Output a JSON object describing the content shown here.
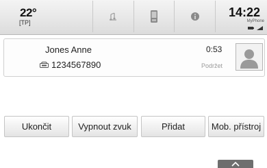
{
  "status": {
    "temperature": "22°",
    "temp_mode": "[TP]",
    "time": "14:22",
    "operator": "MyPhone"
  },
  "tabs": [
    {
      "icon": "music-note-icon"
    },
    {
      "icon": "phone-icon"
    },
    {
      "icon": "info-icon"
    }
  ],
  "call": {
    "contact_name": "Jones Anne",
    "number": "1234567890",
    "duration": "0:53",
    "hold_label": "Podržet",
    "avatar_icon": "contact-silhouette-icon"
  },
  "buttons": {
    "end": "Ukončit",
    "mute": "Vypnout zvuk",
    "add": "Přidat",
    "mobile": "Mob. přístroj"
  },
  "scroll": {
    "icon": "chevron-up-icon"
  }
}
